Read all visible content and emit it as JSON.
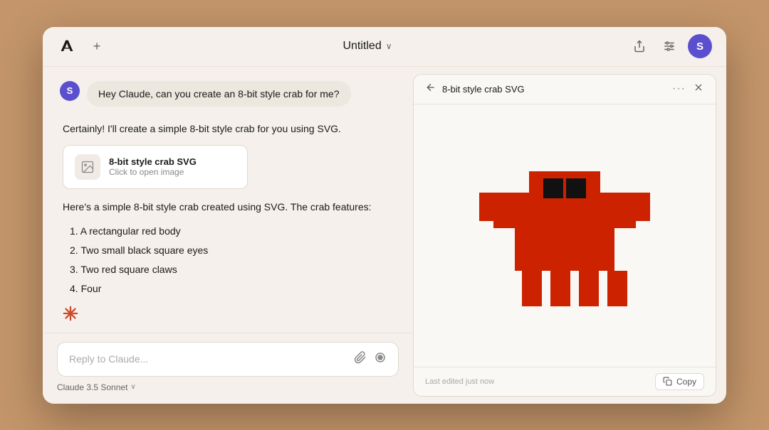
{
  "titleBar": {
    "title": "Untitled",
    "chevron": "∨",
    "newChatLabel": "+",
    "avatarInitial": "S"
  },
  "userMessage": {
    "avatarInitial": "S",
    "text": "Hey Claude, can you create an 8-bit style crab for me?"
  },
  "assistantMessage": {
    "intro": "Certainly! I'll create a simple 8-bit style crab for you using SVG.",
    "artifactTitle": "8-bit style crab SVG",
    "artifactSubtitle": "Click to open image",
    "responseIntro": "Here's a simple 8-bit style crab created using SVG. The crab features:",
    "features": [
      "1. A rectangular red body",
      "2. Two small black square eyes",
      "3. Two red square claws",
      "4. Four"
    ]
  },
  "chatInput": {
    "placeholder": "Reply to Claude...",
    "modelName": "Claude 3.5 Sonnet",
    "chevron": "∨"
  },
  "artifactPanel": {
    "title": "8-bit style crab SVG",
    "footerTimestamp": "Last edited just now",
    "copyLabel": "Copy",
    "ellipsis": "···"
  },
  "icons": {
    "share": "↑",
    "settings": "≡",
    "back": "←",
    "close": "×",
    "attach": "📎",
    "record": "⊙",
    "copy": "⧉"
  },
  "colors": {
    "background": "#c4956a",
    "appBg": "#f5f0eb",
    "userBubble": "#ece7df",
    "accentRed": "#cc2200",
    "avatarPurple": "#5b4fcf",
    "artifactPanelBg": "#faf8f5"
  }
}
